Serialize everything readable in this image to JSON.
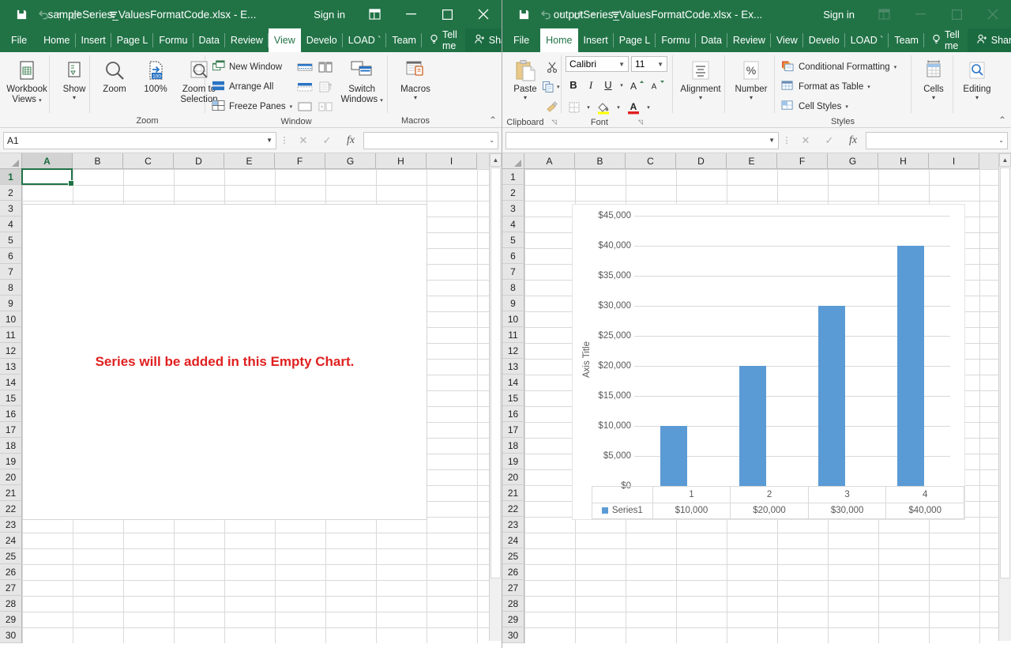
{
  "windows": {
    "left": {
      "title": "sampleSeries_ValuesFormatCode.xlsx  -  E...",
      "signin": "Sign in",
      "qat": {
        "save": "save-icon",
        "undo": "undo-icon",
        "redo": "redo-icon",
        "more": "customize-qat-icon"
      },
      "tabs": [
        {
          "label": "File",
          "active": false
        },
        {
          "label": "Home",
          "active": false
        },
        {
          "label": "Insert",
          "active": false
        },
        {
          "label": "Page L",
          "active": false
        },
        {
          "label": "Formu",
          "active": false
        },
        {
          "label": "Data",
          "active": false
        },
        {
          "label": "Review",
          "active": false
        },
        {
          "label": "View",
          "active": true
        },
        {
          "label": "Develo",
          "active": false
        },
        {
          "label": "LOAD `",
          "active": false
        },
        {
          "label": "Team",
          "active": false
        }
      ],
      "tell_me": "Tell me",
      "share": "Share",
      "ribbon": {
        "groups": [
          {
            "caption": "",
            "items": [
              {
                "label": "Workbook\nViews",
                "type": "big",
                "dropdown": true
              },
              {
                "label": "Show",
                "type": "big",
                "dropdown": true
              }
            ]
          },
          {
            "caption": "Zoom",
            "items": [
              {
                "label": "Zoom",
                "type": "big",
                "dropdown": false
              },
              {
                "label": "100%",
                "type": "big",
                "dropdown": false
              },
              {
                "label": "Zoom to\nSelection",
                "type": "big",
                "dropdown": false
              }
            ]
          },
          {
            "caption": "Window",
            "items": [
              {
                "label": "New Window",
                "type": "small"
              },
              {
                "label": "Arrange All",
                "type": "small"
              },
              {
                "label": "Freeze Panes",
                "type": "small",
                "dropdown": true
              },
              {
                "label": "Switch\nWindows",
                "type": "big",
                "dropdown": true
              }
            ]
          },
          {
            "caption": "Macros",
            "items": [
              {
                "label": "Macros",
                "type": "big",
                "dropdown": true
              }
            ]
          }
        ]
      },
      "namebox": "A1",
      "formula_value": "",
      "columns": [
        "A",
        "B",
        "C",
        "D",
        "E",
        "F",
        "G",
        "H",
        "I"
      ],
      "selected_column": "A",
      "selected_cell": "A1",
      "rows": [
        1,
        2,
        3,
        4,
        5,
        6,
        7,
        8,
        9,
        10,
        11,
        12,
        13,
        14,
        15,
        16,
        17,
        18,
        19,
        20,
        21,
        22,
        23,
        24,
        25,
        26,
        27,
        28,
        29,
        30
      ],
      "empty_chart_message": "Series will be added in this Empty Chart."
    },
    "right": {
      "title": "outputSeries_ValuesFormatCode.xlsx  -  Ex...",
      "signin": "Sign in",
      "qat": {
        "save": "save-icon",
        "undo": "undo-icon",
        "redo": "redo-icon",
        "more": "customize-qat-icon"
      },
      "tabs": [
        {
          "label": "File",
          "active": false
        },
        {
          "label": "Home",
          "active": true
        },
        {
          "label": "Insert",
          "active": false
        },
        {
          "label": "Page L",
          "active": false
        },
        {
          "label": "Formu",
          "active": false
        },
        {
          "label": "Data",
          "active": false
        },
        {
          "label": "Review",
          "active": false
        },
        {
          "label": "View",
          "active": false
        },
        {
          "label": "Develo",
          "active": false
        },
        {
          "label": "LOAD `",
          "active": false
        },
        {
          "label": "Team",
          "active": false
        }
      ],
      "tell_me": "Tell me",
      "share": "Share",
      "ribbon": {
        "clipboard": {
          "caption": "Clipboard",
          "paste": "Paste",
          "cut": "cut-icon",
          "copy": "copy-icon",
          "format_painter": "format-painter-icon"
        },
        "font": {
          "caption": "Font",
          "font_name": "Calibri",
          "font_size": "11",
          "bold": "B",
          "italic": "I",
          "underline": "U",
          "grow": "A",
          "shrink": "A"
        },
        "alignment": {
          "caption": "Alignment",
          "label": "Alignment"
        },
        "number": {
          "caption": "Number",
          "label": "Number",
          "symbol": "%"
        },
        "styles": {
          "caption": "Styles",
          "items": [
            "Conditional Formatting",
            "Format as Table",
            "Cell Styles"
          ]
        },
        "cells": {
          "label": "Cells"
        },
        "editing": {
          "label": "Editing"
        }
      },
      "namebox": "",
      "formula_value": "",
      "columns": [
        "A",
        "B",
        "C",
        "D",
        "E",
        "F",
        "G",
        "H",
        "I"
      ],
      "rows": [
        1,
        2,
        3,
        4,
        5,
        6,
        7,
        8,
        9,
        10,
        11,
        12,
        13,
        14,
        15,
        16,
        17,
        18,
        19,
        20,
        21,
        22,
        23,
        24,
        25,
        26,
        27,
        28,
        29,
        30
      ]
    }
  },
  "chart_data": {
    "type": "bar",
    "title": "",
    "xlabel": "",
    "ylabel": "Axis Title",
    "categories": [
      "1",
      "2",
      "3",
      "4"
    ],
    "values": [
      10000,
      20000,
      30000,
      40000
    ],
    "value_labels": [
      "$10,000",
      "$20,000",
      "$30,000",
      "$40,000"
    ],
    "series": [
      {
        "name": "Series1",
        "values": [
          10000,
          20000,
          30000,
          40000
        ],
        "color": "#5b9bd5"
      }
    ],
    "ylim": [
      0,
      45000
    ],
    "ytick_values": [
      0,
      5000,
      10000,
      15000,
      20000,
      25000,
      30000,
      35000,
      40000,
      45000
    ],
    "ytick_labels": [
      "$0",
      "$5,000",
      "$10,000",
      "$15,000",
      "$20,000",
      "$25,000",
      "$30,000",
      "$35,000",
      "$40,000",
      "$45,000"
    ],
    "grid": true,
    "legend": "data-table",
    "legend_position": "bottom",
    "data_table_visible": true
  }
}
